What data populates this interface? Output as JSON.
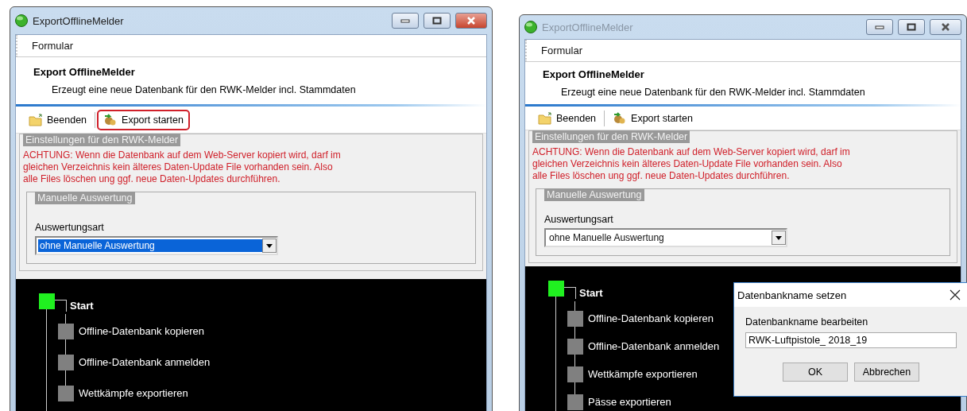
{
  "windows": [
    {
      "title": "ExportOfflineMelder",
      "active": true,
      "menu": [
        "Formular"
      ],
      "header": {
        "title": "Export OfflineMelder",
        "subtitle": "Erzeugt eine neue Datenbank für den RWK-Melder incl. Stammdaten"
      },
      "toolbar": [
        {
          "label": "Beenden",
          "kind": "exit",
          "highlighted": false
        },
        {
          "label": "Export starten",
          "kind": "export",
          "highlighted": true
        }
      ],
      "settings": {
        "legend": "Einstellungen für den RWK-Melder",
        "warning": "ACHTUNG: Wenn die Datenbank auf dem Web-Server kopiert wird, darf im\ngleichen Verzeichnis kein älteres Daten-Update File vorhanden sein. Also\nalle Files löschen ung ggf. neue Daten-Updates durchführen.",
        "group": {
          "legend": "Manuelle Auswertung",
          "label": "Auswertungsart",
          "value": "ohne Manuelle Auswertung",
          "focused": true
        }
      },
      "steps": [
        {
          "label": "Start",
          "active": true
        },
        {
          "label": "Offline-Datenbank kopieren",
          "active": false
        },
        {
          "label": "Offline-Datenbank anmelden",
          "active": false
        },
        {
          "label": "Wettkämpfe exportieren",
          "active": false
        }
      ]
    },
    {
      "title": "ExportOfflineMelder",
      "active": false,
      "menu": [
        "Formular"
      ],
      "header": {
        "title": "Export OfflineMelder",
        "subtitle": "Erzeugt eine neue Datenbank für den RWK-Melder incl. Stammdaten"
      },
      "toolbar": [
        {
          "label": "Beenden",
          "kind": "exit",
          "highlighted": false
        },
        {
          "label": "Export starten",
          "kind": "export",
          "highlighted": false
        }
      ],
      "settings": {
        "legend": "Einstellungen für den RWK-Melder",
        "warning": "ACHTUNG: Wenn die Datenbank auf dem Web-Server kopiert wird, darf im\ngleichen Verzeichnis kein älteres Daten-Update File vorhanden sein. Also\nalle Files löschen ung ggf. neue Daten-Updates durchführen.",
        "group": {
          "legend": "Manuelle Auswertung",
          "label": "Auswertungsart",
          "value": "ohne Manuelle Auswertung",
          "focused": false
        }
      },
      "steps": [
        {
          "label": "Start",
          "active": true
        },
        {
          "label": "Offline-Datenbank kopieren",
          "active": false
        },
        {
          "label": "Offline-Datenbank anmelden",
          "active": false
        },
        {
          "label": "Wettkämpfe exportieren",
          "active": false
        },
        {
          "label": "Pässe exportieren",
          "active": false
        }
      ],
      "dialog": {
        "title": "Datenbankname setzen",
        "label": "Datenbankname bearbeiten",
        "value": "RWK-Luftpistole_ 2018_19",
        "buttons": [
          "OK",
          "Abbrechen"
        ]
      }
    }
  ]
}
